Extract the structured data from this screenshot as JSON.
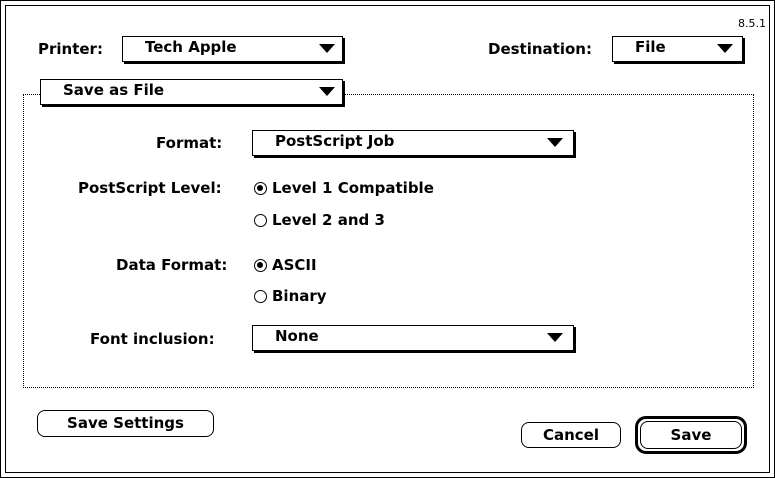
{
  "version": "8.5.1",
  "printer": {
    "label": "Printer:",
    "value": "Tech Apple"
  },
  "destination": {
    "label": "Destination:",
    "value": "File"
  },
  "panel_popup": {
    "value": "Save as File"
  },
  "format": {
    "label": "Format:",
    "value": "PostScript Job"
  },
  "postscript_level": {
    "label": "PostScript Level:",
    "options": [
      {
        "label": "Level 1 Compatible",
        "selected": true
      },
      {
        "label": "Level 2 and 3",
        "selected": false
      }
    ]
  },
  "data_format": {
    "label": "Data Format:",
    "options": [
      {
        "label": "ASCII",
        "selected": true
      },
      {
        "label": "Binary",
        "selected": false
      }
    ]
  },
  "font_inclusion": {
    "label": "Font inclusion:",
    "value": "None"
  },
  "buttons": {
    "save_settings": "Save Settings",
    "cancel": "Cancel",
    "save": "Save"
  }
}
